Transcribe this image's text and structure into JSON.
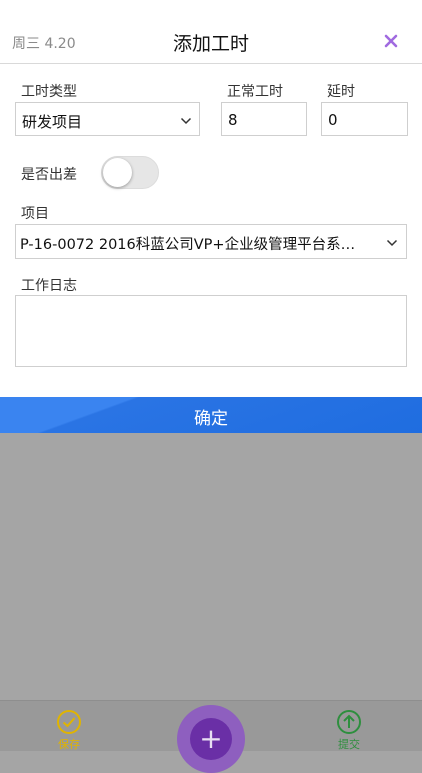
{
  "header": {
    "date": "周三 4.20",
    "title": "添加工时"
  },
  "form": {
    "work_type": {
      "label": "工时类型",
      "value": "研发项目"
    },
    "normal_hours": {
      "label": "正常工时",
      "value": "8"
    },
    "overtime": {
      "label": "延时",
      "value": "0"
    },
    "business_trip": {
      "label": "是否出差",
      "on": false
    },
    "project": {
      "label": "项目",
      "value": "P-16-0072  2016科蓝公司VP+企业级管理平台系…"
    },
    "work_log": {
      "label": "工作日志",
      "value": ""
    }
  },
  "confirm_label": "确定",
  "bottom_bar": {
    "save_label": "保存",
    "submit_label": "提交",
    "add_symbol": "+"
  },
  "colors": {
    "primary_blue": "#2a74e4",
    "accent_purple": "#6a2fa6",
    "close_purple": "#a06ae0",
    "save_yellow": "#e0b400",
    "submit_green": "#2e8f3e",
    "overlay_gray": "#a5a5a5"
  }
}
